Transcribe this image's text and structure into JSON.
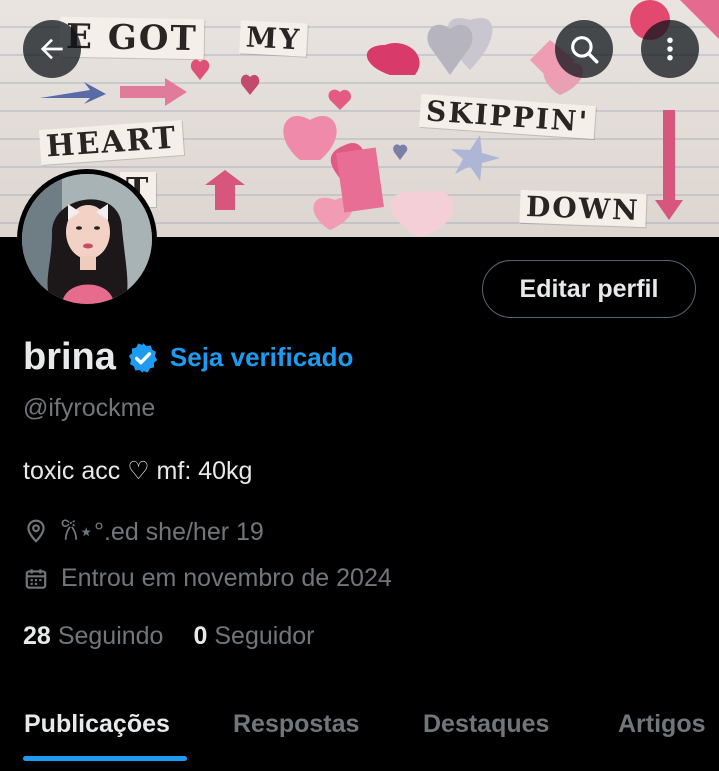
{
  "banner": {
    "words": [
      "E GOT",
      "MY",
      "HEART",
      "SKIPPIN'",
      "DOWN",
      "T"
    ]
  },
  "header": {
    "back_icon": "arrow-left-icon",
    "search_icon": "search-icon",
    "more_icon": "more-vertical-icon"
  },
  "profile": {
    "edit_label": "Editar perfil",
    "display_name": "brina",
    "verify_label": "Seja verificado",
    "handle": "@ifyrockme",
    "bio": "toxic acc ♡ mf: 40kg",
    "location": "𐙚⋆°.ed she/her 19",
    "joined": "Entrou em novembro de 2024",
    "following_count": "28",
    "following_label": "Seguindo",
    "followers_count": "0",
    "followers_label": "Seguidor"
  },
  "tabs": [
    "Publicações",
    "Respostas",
    "Destaques",
    "Artigos"
  ],
  "colors": {
    "accent": "#1d9bf0",
    "background": "#000000",
    "text_primary": "#e7e9ea",
    "text_secondary": "#71767b"
  }
}
